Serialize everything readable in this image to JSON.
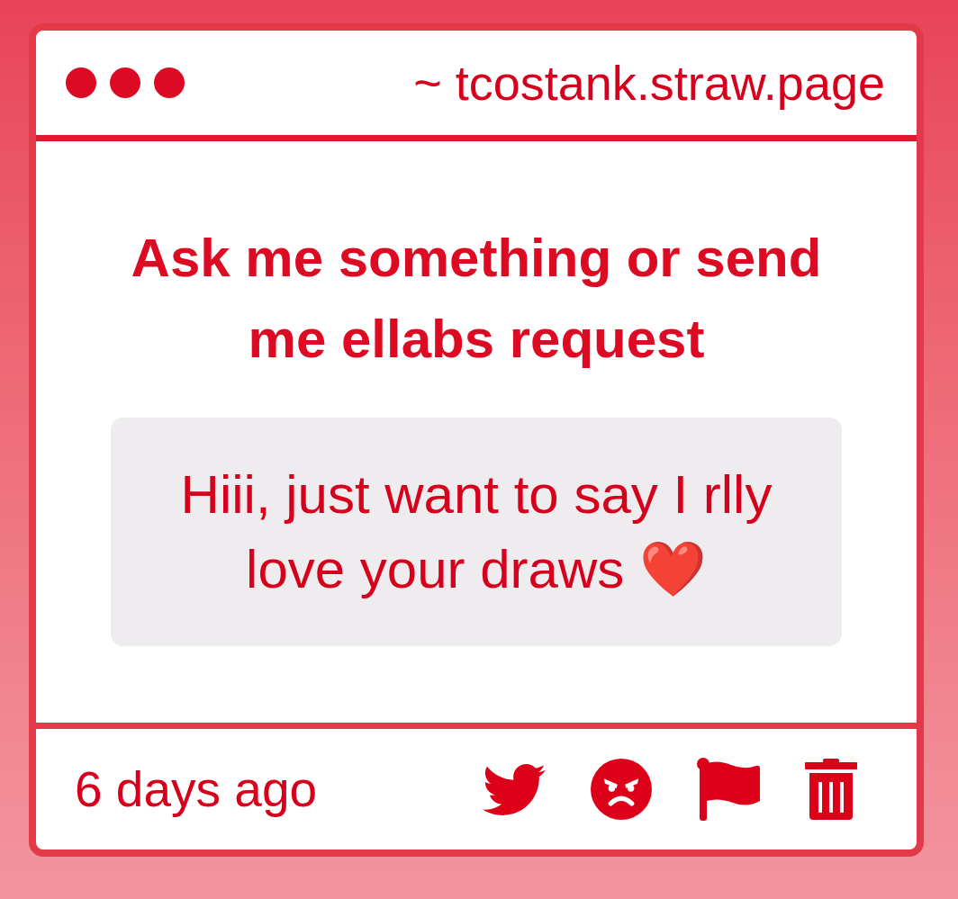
{
  "window": {
    "address": "~ tcostank.straw.page"
  },
  "prompt": {
    "title": "Ask me something or send me ellabs request"
  },
  "message": {
    "text": "Hiii, just want to say I rlly love your draws ❤️"
  },
  "footer": {
    "time": "6 days ago"
  }
}
